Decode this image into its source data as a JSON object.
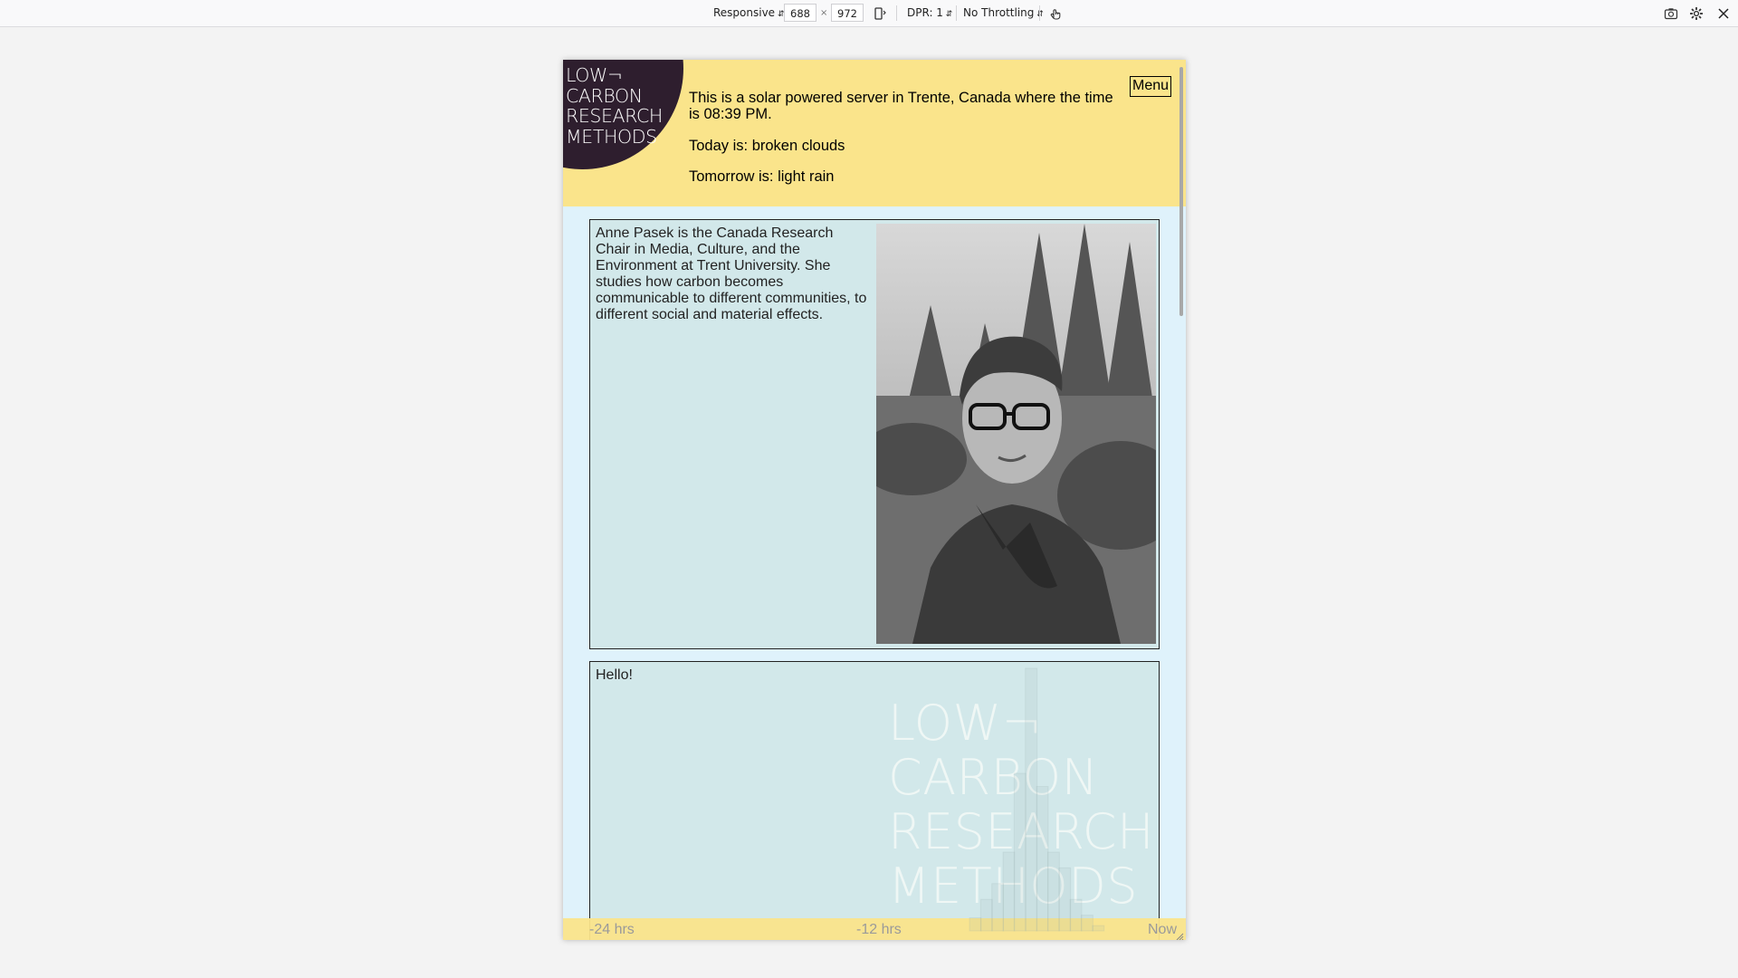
{
  "devtools": {
    "device_mode": "Responsive",
    "width": "688",
    "times": "×",
    "height": "972",
    "dpr": "DPR: 1",
    "throttling": "No Throttling",
    "icons": [
      "rotate-icon",
      "touch-icon",
      "screenshot-icon",
      "settings-icon",
      "close-icon"
    ]
  },
  "site": {
    "logo_lines": [
      "LOW¬",
      "CARBON",
      "RESEARCH",
      "METHODS"
    ],
    "menu_label": "Menu",
    "server_status": "This is a solar powered server in Trente, Canada where the time is 08:39 PM.",
    "weather_today": "Today is: broken clouds",
    "weather_tomorrow": "Tomorrow is: light rain",
    "bio": "Anne Pasek is the Canada Research Chair in Media, Culture, and the Environment at Trent University. She studies how carbon becomes communicable to different communities, to different social and material effects.",
    "hello": "Hello!"
  },
  "battery_chart": {
    "x_labels": [
      "-24 hrs",
      "-12 hrs",
      "Now"
    ],
    "values": [
      0,
      0,
      0,
      0,
      0,
      0,
      0,
      0,
      0,
      0,
      0,
      0,
      0,
      0,
      0,
      0,
      0,
      0,
      0,
      0,
      0,
      0,
      0,
      0,
      0,
      0,
      0,
      0,
      0,
      0,
      0,
      0,
      0,
      0,
      5,
      12,
      18,
      30,
      60,
      100,
      55,
      30,
      24,
      12,
      6,
      2,
      0,
      0,
      0,
      0,
      0
    ]
  },
  "colors": {
    "header_bg": "#fae48b",
    "logo_disc": "#2e1e2e",
    "page_bg": "#dff2fb",
    "card_bg": "#d2e8ea"
  }
}
